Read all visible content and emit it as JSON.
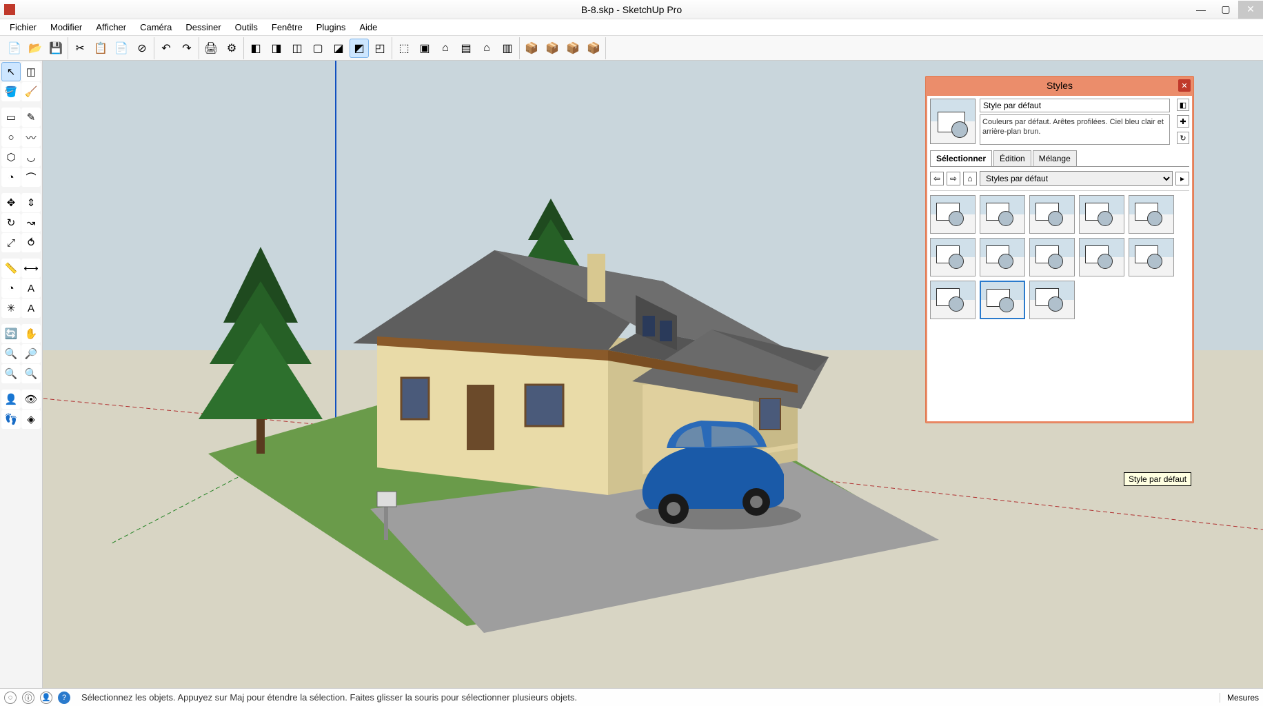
{
  "window": {
    "title": "B-8.skp - SketchUp Pro"
  },
  "menu": {
    "items": [
      "Fichier",
      "Modifier",
      "Afficher",
      "Caméra",
      "Dessiner",
      "Outils",
      "Fenêtre",
      "Plugins",
      "Aide"
    ]
  },
  "styles_panel": {
    "title": "Styles",
    "current_name": "Style par défaut",
    "description": "Couleurs par défaut. Arêtes profilées. Ciel bleu clair et arrière-plan brun.",
    "tabs": [
      "Sélectionner",
      "Édition",
      "Mélange"
    ],
    "dropdown": "Styles par défaut",
    "tooltip": "Style par défaut"
  },
  "status": {
    "hint": "Sélectionnez les objets. Appuyez sur Maj pour étendre la sélection. Faites glisser la souris pour sélectionner plusieurs objets.",
    "measures_label": "Mesures"
  }
}
